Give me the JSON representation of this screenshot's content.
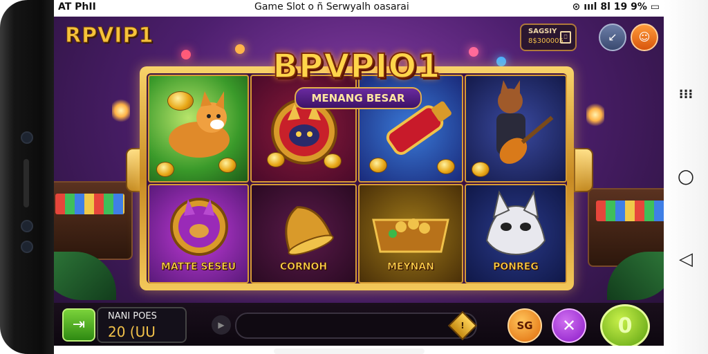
{
  "status_bar": {
    "left": "AT PhII",
    "title": "Game Slot o ñ Serwyalh oasarai",
    "right": "⊙ ıııl 8l 19 9% ▭"
  },
  "game": {
    "logo": "RPVIP1",
    "title": "BPVPIO1",
    "subtitle": "MENANG BESAR",
    "balance_label": "SAGSIY",
    "balance_value": "8$300005",
    "balance_icon": "card-icon"
  },
  "symbols": [
    {
      "name": "corgi-dog",
      "label": ""
    },
    {
      "name": "masked-cat-medallion",
      "label": ""
    },
    {
      "name": "red-golden-bottle",
      "label": ""
    },
    {
      "name": "guitar-cat",
      "label": ""
    },
    {
      "name": "purple-cat-medallion",
      "label": "MATTE SESEU"
    },
    {
      "name": "golden-bell",
      "label": "CORNOH"
    },
    {
      "name": "treasure-chest",
      "label": "MEYNAN"
    },
    {
      "name": "robot-cat",
      "label": "PONREG"
    }
  ],
  "controls": {
    "bet_label": "NANI POES",
    "bet_value": "20  (UU",
    "auto_label": "SG",
    "cancel_symbol": "✕",
    "spin_symbol": "0",
    "diamond_symbol": "!",
    "play_symbol": "▶",
    "arrow_symbol": "⇥"
  },
  "nav": {
    "recent": "⁝⁝⁝",
    "home": "○",
    "back": "◁"
  },
  "colors": {
    "accent_gold": "#f6c33a",
    "spin_green": "#8ccc2a",
    "cancel_purple": "#9a2fd0",
    "auto_orange": "#f08a1a"
  }
}
